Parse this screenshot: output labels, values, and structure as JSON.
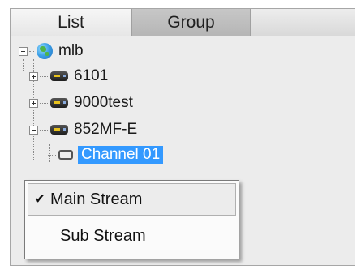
{
  "tabs": [
    {
      "label": "List",
      "active": true
    },
    {
      "label": "Group",
      "active": false
    }
  ],
  "tree": {
    "root": {
      "label": "mlb",
      "icon": "globe-icon",
      "expanded": true
    },
    "devices": [
      {
        "label": "6101",
        "icon": "dvr-device-icon",
        "expanded": false
      },
      {
        "label": "9000test",
        "icon": "dvr-device-icon",
        "expanded": false
      },
      {
        "label": "852MF-E",
        "icon": "dvr-device-icon",
        "expanded": true
      }
    ],
    "channel": {
      "label": "Channel 01",
      "icon": "camera-icon",
      "selected": true
    }
  },
  "context_menu": {
    "items": [
      {
        "label": "Main Stream",
        "checked": true
      },
      {
        "label": "Sub Stream",
        "checked": false
      }
    ],
    "check_glyph": "✔"
  },
  "colors": {
    "selection": "#3399ff",
    "tab_active": "#eeeeee",
    "tab_inactive": "#bdbdbd",
    "panel_bg": "#ececec"
  }
}
